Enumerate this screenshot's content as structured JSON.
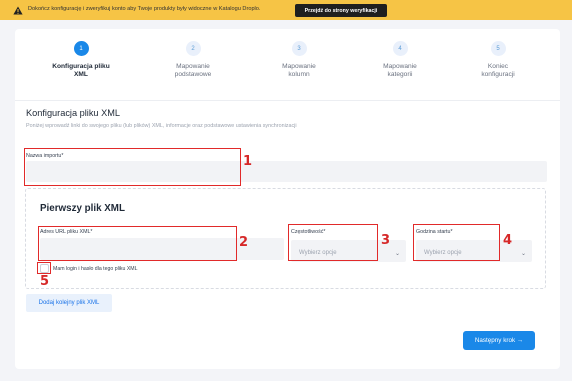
{
  "banner": {
    "message": "Dokończ konfigurację i zweryfikuj konto aby Twoje produkty były widoczne w Katalogu Droplo.",
    "button_label": "Przejdź do strony weryfikacji",
    "icon": "warning-icon"
  },
  "steps": [
    {
      "num": "1",
      "label": "Konfiguracja pliku\nXML",
      "active": true
    },
    {
      "num": "2",
      "label": "Mapowanie\npodstawowe",
      "active": false
    },
    {
      "num": "3",
      "label": "Mapowanie\nkolumn",
      "active": false
    },
    {
      "num": "4",
      "label": "Mapowanie\nkategorii",
      "active": false
    },
    {
      "num": "5",
      "label": "Koniec\nkonfiguracji",
      "active": false
    }
  ],
  "section": {
    "title": "Konfiguracja pliku XML",
    "description": "Poniżej wprowadź linki do swojego pliku (lub plików) XML, informacje oraz podstawowe ustawienia synchronizacji"
  },
  "import_name": {
    "label": "Nazwa importu*",
    "value": ""
  },
  "xml_file": {
    "title": "Pierwszy plik XML",
    "url_label": "Adres URL pliku XML*",
    "url_value": "",
    "frequency_label": "Częstotliwość*",
    "frequency_placeholder": "Wybierz opcje",
    "start_time_label": "Godzina startu*",
    "start_time_placeholder": "Wybierz opcje",
    "checkbox_label": "Mam login i hasło dla tego pliku XML",
    "checkbox_checked": false
  },
  "add_file_button": "Dodaj kolejny plik XML",
  "next_button": "Następny krok →",
  "annotations": [
    "1",
    "2",
    "3",
    "4",
    "5"
  ],
  "colors": {
    "accent": "#1a88e8",
    "banner": "#f6c445",
    "annotation": "#e12a2a"
  }
}
